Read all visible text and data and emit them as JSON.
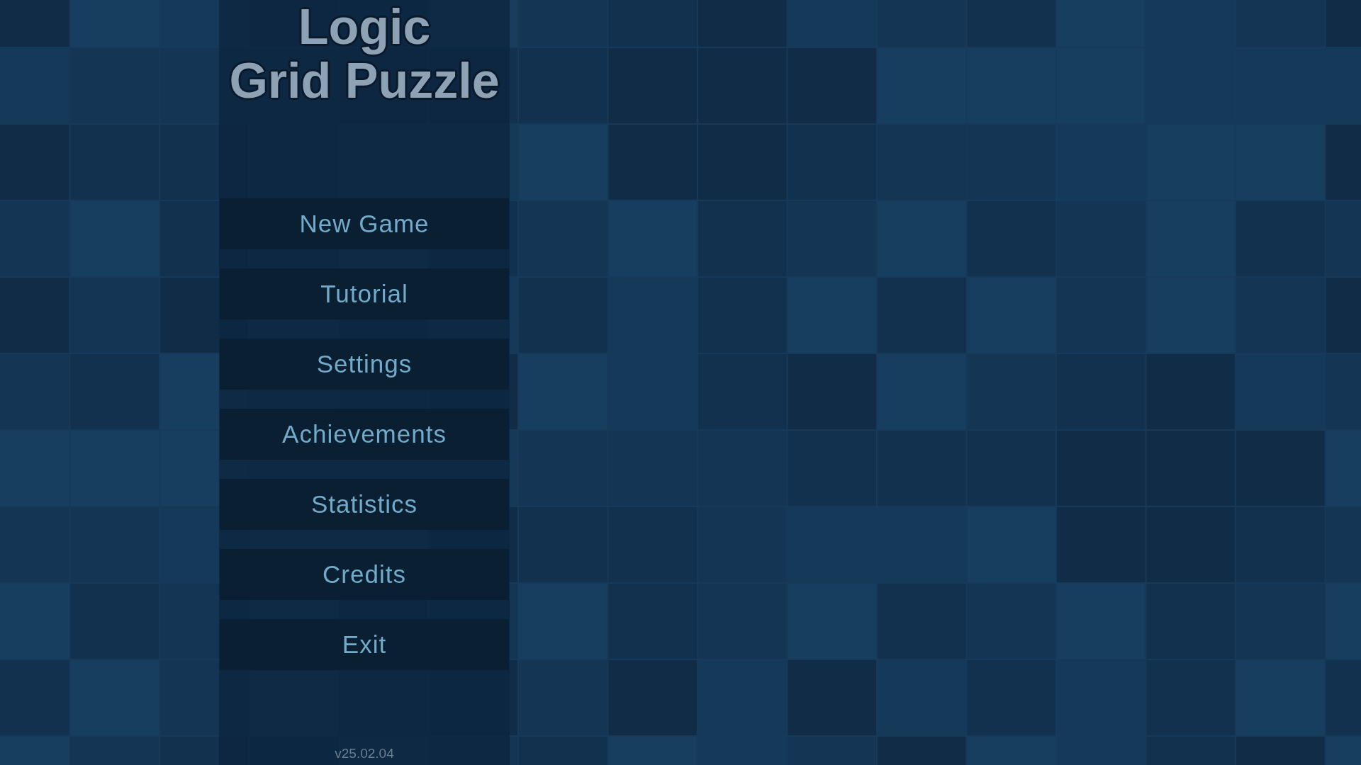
{
  "title": {
    "lines": [
      "Logic",
      "Grid Puzzle"
    ]
  },
  "menu": [
    "New Game",
    "Tutorial",
    "Settings",
    "Achievements",
    "Statistics",
    "Credits",
    "Exit"
  ],
  "version": "v25.02.04"
}
